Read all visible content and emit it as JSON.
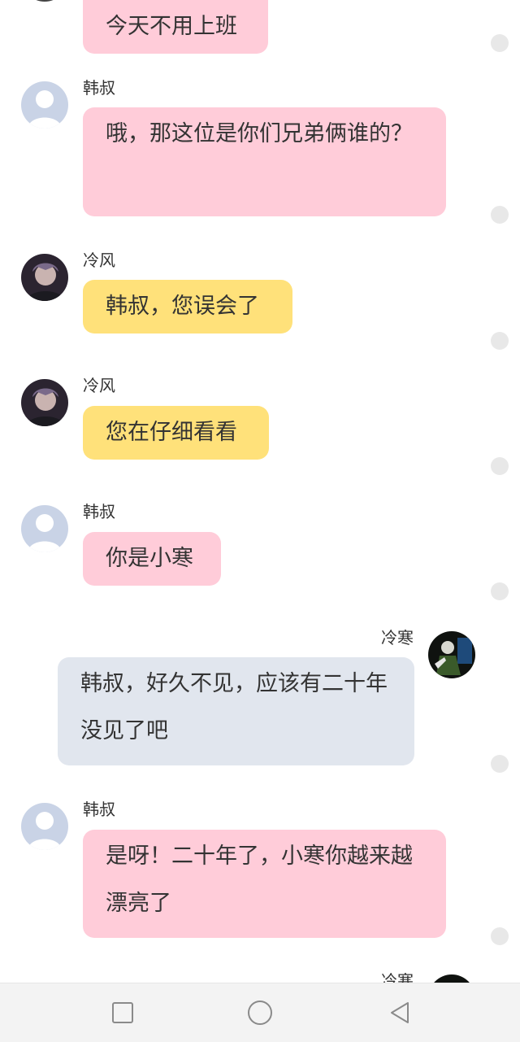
{
  "messages": [
    {
      "sender": "",
      "text": "今天不用上班",
      "style": "pink",
      "side": "left"
    },
    {
      "sender": "韩叔",
      "text": "哦，那这位是你们兄弟俩谁的？",
      "style": "pink",
      "side": "left"
    },
    {
      "sender": "冷风",
      "text": "韩叔，您误会了",
      "style": "yellow",
      "side": "left"
    },
    {
      "sender": "冷风",
      "text": "您在仔细看看",
      "style": "yellow",
      "side": "left"
    },
    {
      "sender": "韩叔",
      "text": "你是小寒",
      "style": "pink",
      "side": "left"
    },
    {
      "sender": "冷寒",
      "text": "韩叔，好久不见，应该有二十年没见了吧",
      "style": "gray",
      "side": "right"
    },
    {
      "sender": "韩叔",
      "text": "是呀！二十年了，小寒你越来越漂亮了",
      "style": "pink",
      "side": "left"
    },
    {
      "sender": "冷寒",
      "text": "",
      "style": "",
      "side": "right"
    }
  ],
  "avatars": {
    "han_shu": "default-person-icon",
    "leng_feng": "photo-avatar",
    "leng_han": "photo-avatar"
  },
  "colors": {
    "pink_bubble": "#ffccd9",
    "yellow_bubble": "#ffe17a",
    "gray_bubble": "#e1e6ee",
    "text": "#333333",
    "default_avatar": "#c9d3e6"
  },
  "navigation": {
    "recent_icon": "square-icon",
    "home_icon": "circle-icon",
    "back_icon": "triangle-back-icon"
  }
}
